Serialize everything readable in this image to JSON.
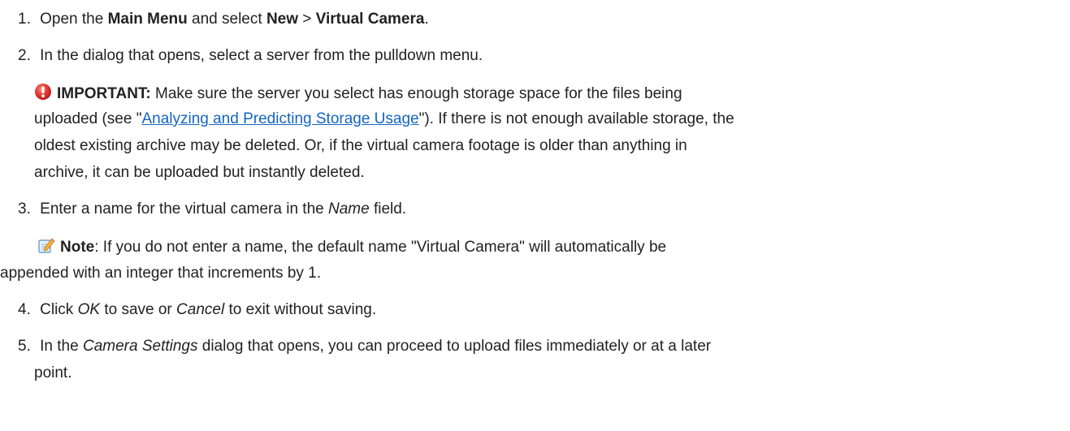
{
  "steps": [
    {
      "number": "1.",
      "before": "Open the ",
      "bold1": "Main Menu",
      "middle": " and select ",
      "bold2": "New",
      "sep": " > ",
      "bold3": "Virtual Camera",
      "after": "."
    },
    {
      "number": "2.",
      "text": "In the dialog that opens, select a server from the pulldown menu."
    },
    {
      "number": "3.",
      "before": "Enter a name for the virtual camera in the ",
      "italic": "Name",
      "after": " field."
    },
    {
      "number": "4.",
      "before": "Click ",
      "italic1": "OK",
      "middle": " to save or ",
      "italic2": "Cancel",
      "after": " to exit without saving."
    },
    {
      "number": "5.",
      "before": "In the ",
      "italic": "Camera Settings",
      "after": " dialog that opens, you can proceed to upload files immediately or at a later",
      "line2": "point."
    }
  ],
  "important": {
    "icon": "important-icon",
    "label": "IMPORTANT:",
    "line1": " Make sure the server you select has enough storage space for the files being",
    "line2_before": "uploaded (see \"",
    "link": "Analyzing and Predicting Storage Usage",
    "line2_after": "\"). If there is not enough available storage, the",
    "line3": "oldest existing archive may be deleted. Or, if the virtual camera footage is older than anything in",
    "line4": "archive, it can be uploaded but instantly deleted."
  },
  "note": {
    "icon": "note-icon",
    "label": "Note",
    "line1": ": If you do not enter a name, the default name \"Virtual Camera\" will automatically be",
    "line2": "appended with an integer that increments by 1."
  },
  "colors": {
    "text": "#222222",
    "link": "#1565c0",
    "important_icon": "#d32f2f"
  }
}
